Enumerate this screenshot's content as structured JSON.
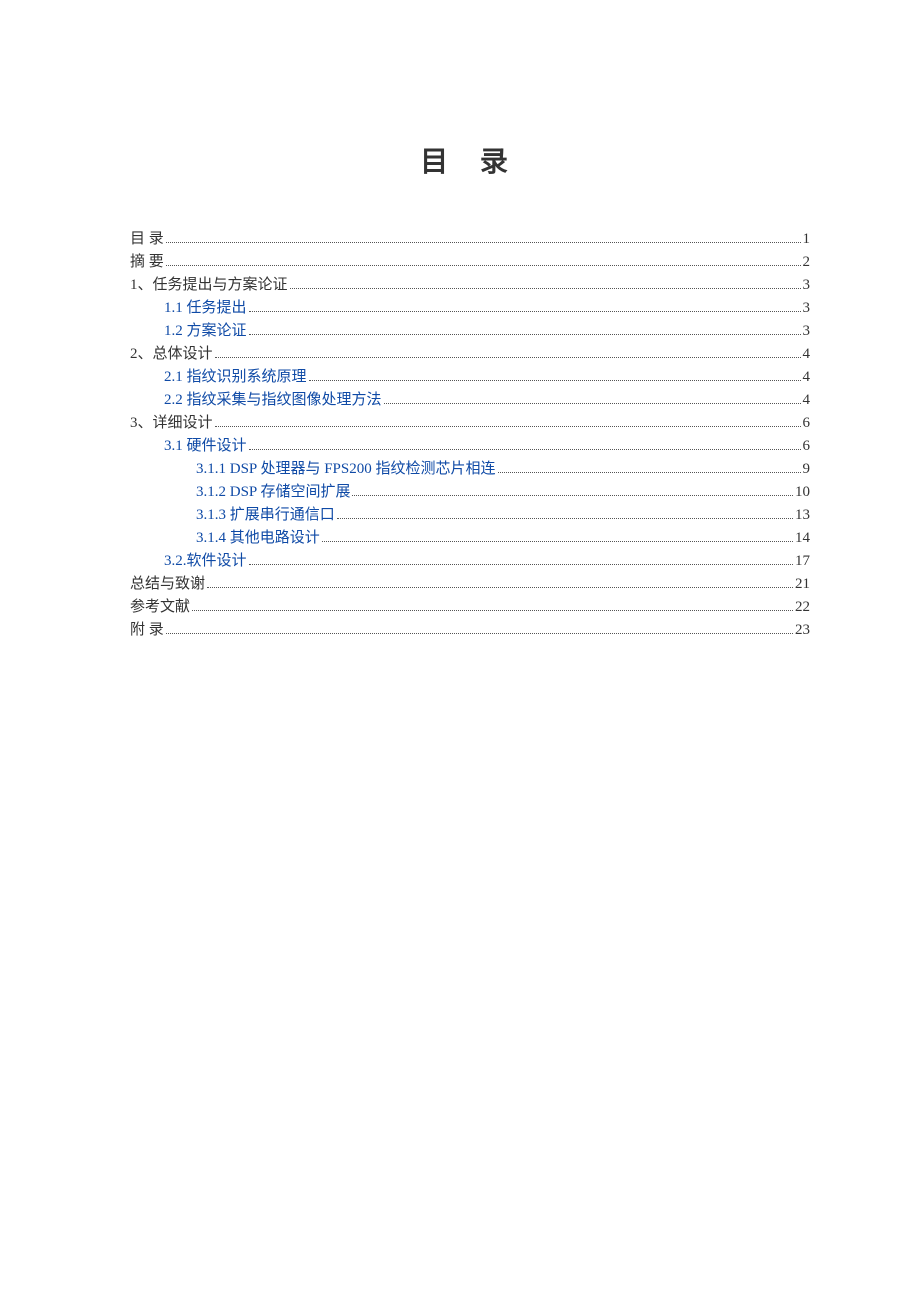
{
  "title": "目 录",
  "toc": [
    {
      "label": "目 录",
      "page": "1",
      "indent": 0,
      "link": false
    },
    {
      "label": "摘 要",
      "page": "2",
      "indent": 0,
      "link": false
    },
    {
      "label": "1、任务提出与方案论证",
      "page": "3",
      "indent": 0,
      "link": false
    },
    {
      "label": "1.1 任务提出",
      "page": "3",
      "indent": 1,
      "link": true
    },
    {
      "label": "1.2 方案论证",
      "page": "3",
      "indent": 1,
      "link": true
    },
    {
      "label": "2、总体设计",
      "page": "4",
      "indent": 0,
      "link": false
    },
    {
      "label": "2.1 指纹识别系统原理",
      "page": "4",
      "indent": 1,
      "link": true
    },
    {
      "label": "2.2 指纹采集与指纹图像处理方法",
      "page": "4",
      "indent": 1,
      "link": true
    },
    {
      "label": "3、详细设计",
      "page": "6",
      "indent": 0,
      "link": false
    },
    {
      "label": "3.1 硬件设计",
      "page": "6",
      "indent": 1,
      "link": true
    },
    {
      "label": "3.1.1 DSP 处理器与 FPS200 指纹检测芯片相连",
      "page": "9",
      "indent": 2,
      "link": true
    },
    {
      "label": "3.1.2 DSP 存储空间扩展 ",
      "page": "10",
      "indent": 2,
      "link": true
    },
    {
      "label": "3.1.3 扩展串行通信口",
      "page": "13",
      "indent": 2,
      "link": true
    },
    {
      "label": "3.1.4 其他电路设计",
      "page": "14",
      "indent": 2,
      "link": true
    },
    {
      "label": "3.2.软件设计",
      "page": "17",
      "indent": 1,
      "link": true
    },
    {
      "label": "总结与致谢",
      "page": "21",
      "indent": 0,
      "link": false
    },
    {
      "label": "参考文献",
      "page": "22",
      "indent": 0,
      "link": false
    },
    {
      "label": "附 录",
      "page": "23",
      "indent": 0,
      "link": false
    }
  ]
}
